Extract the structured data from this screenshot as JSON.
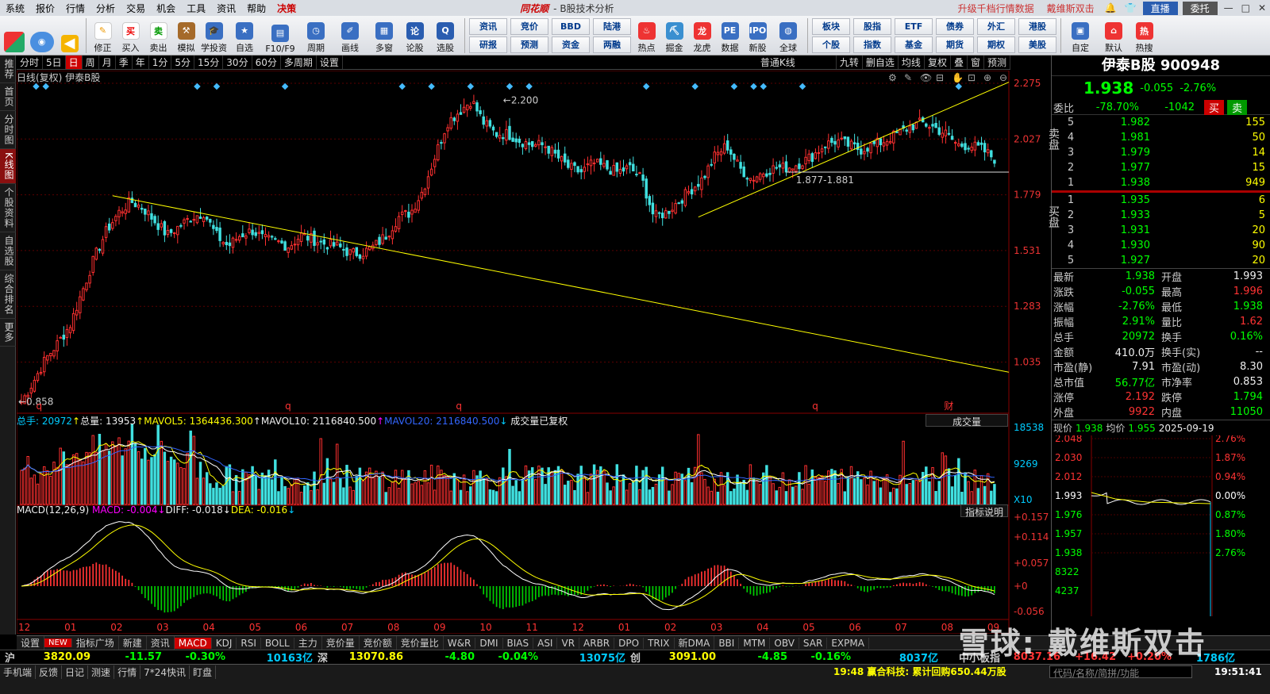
{
  "menu": {
    "items": [
      "系统",
      "报价",
      "行情",
      "分析",
      "交易",
      "机会",
      "工具",
      "资讯",
      "帮助",
      "决策"
    ],
    "logo": "同花顺",
    "window_title": "- B股技术分析",
    "promo1": "升级千档行情数据",
    "promo2": "戴维斯双击",
    "vip": "直播",
    "account": "委托"
  },
  "toolbar": {
    "buttons": [
      "修正",
      "买入",
      "卖出",
      "模拟",
      "学投资",
      "自选",
      "F10/F9",
      "周期",
      "画线",
      "多窗",
      "论股",
      "选股"
    ],
    "grid": [
      [
        "资讯",
        "竞价",
        "BBD",
        "陆港"
      ],
      [
        "研报",
        "预测",
        "资金",
        "两融"
      ]
    ],
    "buttons2": [
      "热点",
      "掘金",
      "龙虎",
      "数据",
      "新股",
      "全球"
    ],
    "grid2": [
      [
        "板块",
        "股指",
        "ETF",
        "债券",
        "外汇",
        "港股"
      ],
      [
        "个股",
        "指数",
        "基金",
        "期货",
        "期权",
        "美股"
      ]
    ],
    "buttons3": [
      "自定",
      "默认",
      "热搜"
    ]
  },
  "sidebar": [
    "推荐",
    "首页",
    "分时图",
    "K线图",
    "个股资料",
    "自选股",
    "综合排名",
    "更多"
  ],
  "periods": [
    "分时",
    "5日",
    "日",
    "周",
    "月",
    "季",
    "年",
    "1分",
    "5分",
    "15分",
    "30分",
    "60分",
    "多周期",
    "设置"
  ],
  "period_active": "日",
  "period_right": [
    "普通K线",
    "九转",
    "删自选",
    "均线",
    "复权",
    "叠",
    "窗",
    "预测"
  ],
  "chart_head": "日线(复权) 伊泰B股",
  "price_axis": [
    "2.275",
    "2.027",
    "1.779",
    "1.531",
    "1.283",
    "1.035"
  ],
  "annotations": {
    "high": "2.200",
    "low": "0.858",
    "range": "1.877-1.881"
  },
  "x_markers": [
    "q",
    "q",
    "q",
    "q",
    "财"
  ],
  "vol_head": {
    "a": "总手: 20972",
    "b": "总量: 13953",
    "c": "MAVOL5: 1364436.300",
    "d": "MAVOL10: 2116840.500",
    "e": "MAVOL20: 2116840.500",
    "f": "成交量已复权",
    "sel": "成交量"
  },
  "vol_axis": [
    "18538",
    "9269",
    "X10"
  ],
  "macd_head": {
    "a": "MACD(12,26,9)",
    "b": "MACD: -0.004",
    "c": "DIFF: -0.018",
    "d": "DEA: -0.016",
    "help": "指标说明"
  },
  "macd_axis": [
    "+0.157",
    "+0.114",
    "+0.057",
    "+0",
    "-0.056"
  ],
  "months": [
    "12",
    "01",
    "02",
    "03",
    "04",
    "05",
    "06",
    "07",
    "08",
    "09",
    "10",
    "11",
    "12",
    "01",
    "02",
    "03",
    "04",
    "05",
    "06",
    "07",
    "08",
    "09"
  ],
  "bottom_tabs": [
    "设置",
    "NEW",
    "指标广场",
    "新建",
    "资讯",
    "MACD",
    "KDJ",
    "RSI",
    "BOLL",
    "主力",
    "竞价量",
    "竞价额",
    "竞价量比",
    "W&R",
    "DMI",
    "BIAS",
    "ASI",
    "VR",
    "ARBR",
    "DPO",
    "TRIX",
    "新DMA",
    "BBI",
    "MTM",
    "OBV",
    "SAR",
    "EXPMA"
  ],
  "index_bar": [
    {
      "n": "沪",
      "v": "3820.09",
      "c": "-11.57",
      "p": "-0.30%",
      "a": "10163亿"
    },
    {
      "n": "深",
      "v": "13070.86",
      "c": "-4.80",
      "p": "-0.04%",
      "a": "13075亿"
    },
    {
      "n": "创",
      "v": "3091.00",
      "c": "-4.85",
      "p": "-0.16%",
      "a": "8037亿"
    }
  ],
  "index_right": {
    "n": "中小板指",
    "v": "8037.16",
    "c": "+16.42",
    "p": "+0.20%",
    "a": "1786亿"
  },
  "status": {
    "items": [
      "手机端",
      "反馈",
      "日记",
      "测速",
      "行情",
      "7*24快讯",
      "盯盘"
    ],
    "news": "19:48 赢合科技: 累计回购650.44万股",
    "search": "代码/名称/简拼/功能",
    "time": "19:51:41"
  },
  "right_panel": {
    "title": "伊泰B股 900948",
    "price": "1.938",
    "change": "-0.055",
    "pct": "-2.76%",
    "wb_label": "委比",
    "wb": "-78.70%",
    "wc": "-1042",
    "buy_btn": "买",
    "sell_btn": "卖",
    "sell_label": "卖盘",
    "buy_label": "买盘",
    "sells": [
      [
        "5",
        "1.982",
        "155"
      ],
      [
        "4",
        "1.981",
        "50"
      ],
      [
        "3",
        "1.979",
        "14"
      ],
      [
        "2",
        "1.977",
        "15"
      ],
      [
        "1",
        "1.938",
        "949"
      ]
    ],
    "buys": [
      [
        "1",
        "1.935",
        "6"
      ],
      [
        "2",
        "1.933",
        "5"
      ],
      [
        "3",
        "1.931",
        "20"
      ],
      [
        "4",
        "1.930",
        "90"
      ],
      [
        "5",
        "1.927",
        "20"
      ]
    ],
    "stats": [
      [
        "最新",
        "1.938",
        "g",
        "开盘",
        "1.993",
        "w"
      ],
      [
        "涨跌",
        "-0.055",
        "g",
        "最高",
        "1.996",
        "r"
      ],
      [
        "涨幅",
        "-2.76%",
        "g",
        "最低",
        "1.938",
        "g"
      ],
      [
        "振幅",
        "2.91%",
        "g",
        "量比",
        "1.62",
        "r"
      ],
      [
        "总手",
        "20972",
        "g",
        "换手",
        "0.16%",
        "g"
      ],
      [
        "金额",
        "410.0万",
        "w",
        "换手(实)",
        "--",
        "w"
      ],
      [
        "市盈(静)",
        "7.91",
        "w",
        "市盈(动)",
        "8.30",
        "w"
      ],
      [
        "总市值",
        "56.77亿",
        "g",
        "市净率",
        "0.853",
        "w"
      ],
      [
        "涨停",
        "2.192",
        "r",
        "跌停",
        "1.794",
        "g"
      ],
      [
        "外盘",
        "9922",
        "r",
        "内盘",
        "11050",
        "g"
      ]
    ],
    "mini_head": {
      "l1": "现价",
      "v1": "1.938",
      "l2": "均价",
      "v2": "1.955",
      "d": "2025-09-19"
    },
    "mini_left": [
      "2.048",
      "2.030",
      "2.012",
      "1.993",
      "1.976",
      "1.957",
      "1.938",
      "8322",
      "4237"
    ],
    "mini_right": [
      "2.76%",
      "1.87%",
      "0.94%",
      "0.00%",
      "0.87%",
      "1.80%",
      "2.76%"
    ]
  },
  "watermark": "雪球: 戴维斯双击",
  "chart_data": {
    "type": "candlestick",
    "symbol": "伊泰B股 900948",
    "ylim": [
      0.85,
      2.275
    ],
    "y_ticks": [
      2.275,
      2.027,
      1.779,
      1.531,
      1.283,
      1.035
    ],
    "x_labels": [
      "12",
      "01",
      "02",
      "03",
      "04",
      "05",
      "06",
      "07",
      "08",
      "09",
      "10",
      "11",
      "12",
      "01",
      "02",
      "03",
      "04",
      "05",
      "06",
      "07",
      "08",
      "09"
    ],
    "close_path": [
      0.858,
      0.95,
      1.05,
      1.12,
      1.2,
      1.35,
      1.5,
      1.62,
      1.7,
      1.75,
      1.72,
      1.66,
      1.6,
      1.64,
      1.68,
      1.7,
      1.6,
      1.55,
      1.6,
      1.62,
      1.58,
      1.57,
      1.55,
      1.6,
      1.58,
      1.56,
      1.55,
      1.52,
      1.52,
      1.55,
      1.6,
      1.68,
      1.7,
      1.8,
      1.95,
      2.1,
      2.15,
      2.2,
      2.1,
      2.05,
      2.05,
      2.02,
      2.0,
      2.0,
      1.95,
      1.9,
      1.88,
      1.92,
      1.9,
      1.88,
      1.9,
      1.85,
      1.68,
      1.7,
      1.75,
      1.8,
      1.85,
      1.95,
      2.0,
      1.9,
      1.85,
      1.88,
      1.9,
      1.9,
      1.92,
      1.95,
      2.0,
      2.02,
      2.0,
      1.98,
      2.0,
      2.02,
      2.05,
      2.08,
      2.1,
      2.08,
      2.05,
      2.0,
      2.0,
      1.98,
      1.94
    ],
    "annotations": {
      "high": 2.2,
      "low": 0.858,
      "range": "1.877-1.881"
    }
  }
}
